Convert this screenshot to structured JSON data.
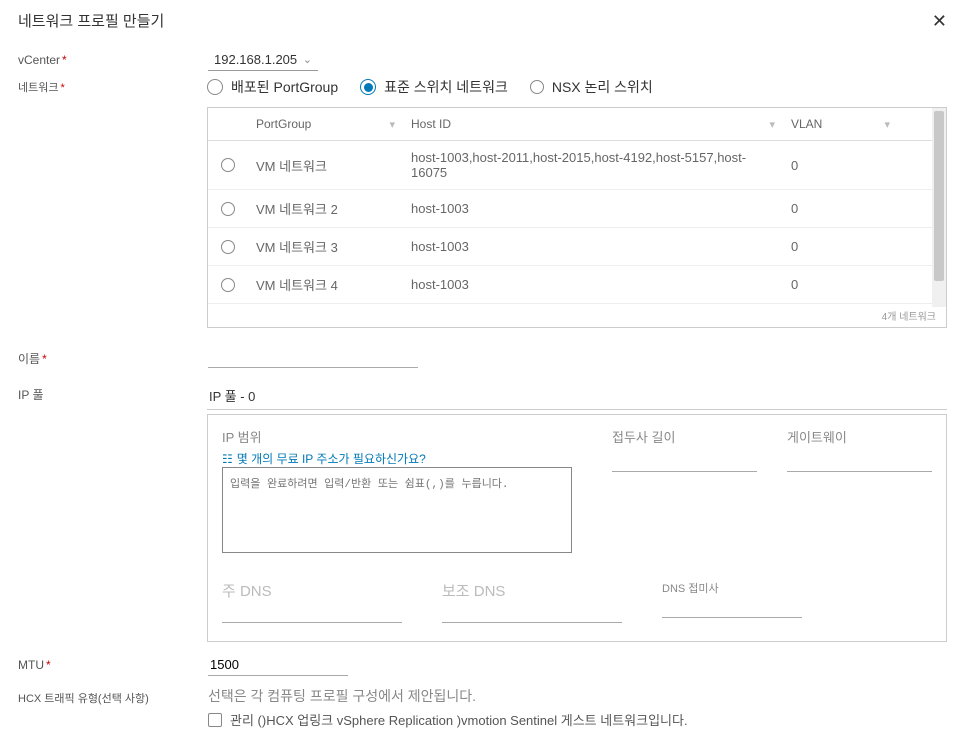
{
  "dialog": {
    "title": "네트워크 프로필 만들기"
  },
  "vcenter": {
    "label": "vCenter",
    "selected": "192.168.1.205"
  },
  "network": {
    "label": "네트워크",
    "options": {
      "deployed": "배포된 PortGroup",
      "standard": "표준 스위치 네트워크",
      "nsx": "NSX 논리 스위치"
    }
  },
  "table": {
    "headers": {
      "portgroup": "PortGroup",
      "hostid": "Host ID",
      "vlan": "VLAN"
    },
    "rows": [
      {
        "pg": "VM 네트워크",
        "host": "host-1003,host-2011,host-2015,host-4192,host-5157,host-16075",
        "vlan": "0"
      },
      {
        "pg": "VM 네트워크 2",
        "host": "host-1003",
        "vlan": "0"
      },
      {
        "pg": "VM 네트워크 3",
        "host": "host-1003",
        "vlan": "0"
      },
      {
        "pg": "VM 네트워크 4",
        "host": "host-1003",
        "vlan": "0"
      }
    ],
    "footer": "4개 네트워크"
  },
  "name": {
    "label": "이름"
  },
  "ip_pool": {
    "label": "IP 풀",
    "header": "IP 풀 - 0",
    "range_label": "IP 범위",
    "help_link": "몇 개의 무료 IP 주소가 필요하신가요?",
    "textarea_placeholder": "입력을 완료하려면 입력/반환 또는 쉼표(,)를 누릅니다.",
    "prefix_label": "접두사 길이",
    "gateway_label": "게이트웨이",
    "dns_primary": "주 DNS",
    "dns_secondary": "보조 DNS",
    "dns_suffix": "DNS 접미사"
  },
  "mtu": {
    "label": "MTU",
    "value": "1500"
  },
  "traffic": {
    "label": "HCX 트래픽 유형(선택 사항)",
    "note": "선택은 각 컴퓨팅 프로필 구성에서 제안됩니다.",
    "options_text": "관리 ()HCX 업링크 vSphere Replication  )vmotion Sentinel 게스트  네트워크입니다."
  }
}
